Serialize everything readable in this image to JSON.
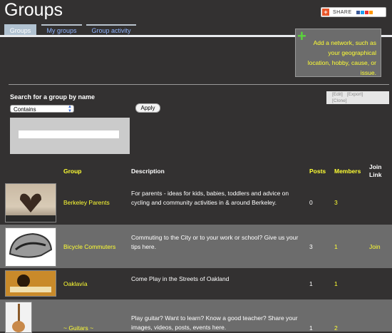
{
  "page": {
    "title": "Groups"
  },
  "share": {
    "label": "SHARE"
  },
  "tabs": [
    {
      "label": "Groups"
    },
    {
      "label": "My groups"
    },
    {
      "label": "Group activity"
    }
  ],
  "network_prompt": {
    "text": "Add a network, such as your geographical location, hobby, cause, or issue."
  },
  "search": {
    "label": "Search for a group by name",
    "mode": "Contains",
    "apply_label": "Apply",
    "value": ""
  },
  "edit_links": {
    "edit": "[Edit]",
    "export": "[Export]",
    "clone": "[Clone]"
  },
  "table": {
    "headers": {
      "group": "Group",
      "description": "Description",
      "posts": "Posts",
      "members": "Members",
      "join": "Join Link"
    },
    "rows": [
      {
        "name": "Berkeley Parents",
        "description": "For parents - ideas for kids, babies, toddlers and advice on cycling and community activities in & around Berkeley.",
        "posts": "0",
        "members": "3",
        "join": ""
      },
      {
        "name": "Bicycle Commuters",
        "description": "Commuting to the City or to your work or school? Give us your tips here.",
        "posts": "3",
        "members": "1",
        "join": "Join"
      },
      {
        "name": "Oaklavía",
        "description": "Come Play in the Streets of Oakland",
        "posts": "1",
        "members": "1",
        "join": ""
      },
      {
        "name": "~ Guitars ~",
        "description": "Play guitar? Want to learn? Know a good teacher? Share your images, videos, posts, events here.",
        "posts": "1",
        "members": "2",
        "join": ""
      }
    ]
  }
}
